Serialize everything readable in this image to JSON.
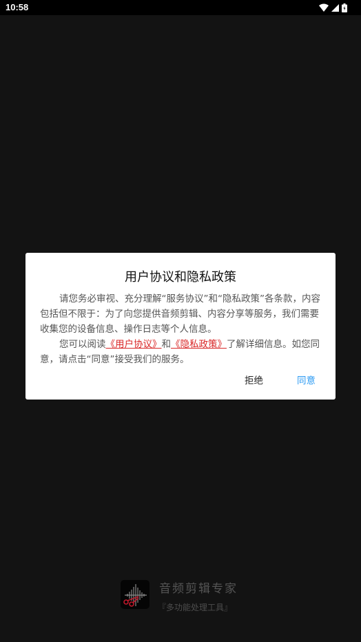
{
  "status_bar": {
    "time": "10:58",
    "icons": [
      "wifi-icon",
      "signal-icon",
      "battery-icon"
    ]
  },
  "dialog": {
    "title": "用户协议和隐私政策",
    "paragraph1": "请您务必审视、充分理解“服务协议”和“隐私政策”各条款，内容包括但不限于：为了向您提供音频剪辑、内容分享等服务，我们需要收集您的设备信息、操作日志等个人信息。",
    "paragraph2_prefix": "您可以阅读",
    "user_agreement_link": "《用户协议》",
    "paragraph2_and": "和",
    "privacy_policy_link": "《隐私政策》",
    "paragraph2_suffix": "了解详细信息。如您同意，请点击“同意”接受我们的服务。",
    "reject_label": "拒绝",
    "agree_label": "同意"
  },
  "brand": {
    "name": "音频剪辑专家",
    "slogan": "『多功能处理工具』"
  },
  "colors": {
    "background": "#131313",
    "link": "#d92626",
    "agree": "#2b9af3"
  }
}
